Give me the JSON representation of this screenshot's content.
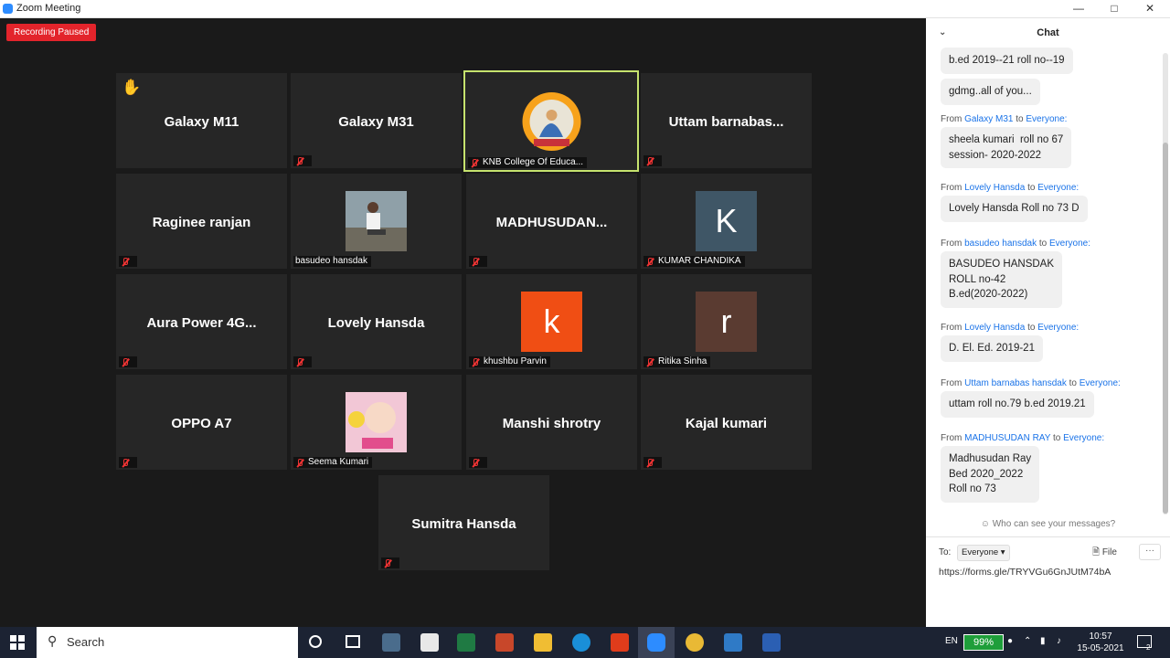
{
  "window": {
    "title": "Zoom Meeting"
  },
  "meeting": {
    "recording_badge": "Recording Paused",
    "tiles": [
      {
        "name": "Galaxy M11",
        "label": "",
        "muted": false,
        "hand": true
      },
      {
        "name": "Galaxy M31",
        "label": "",
        "muted": true
      },
      {
        "name": "",
        "label": "KNB College Of Educa...",
        "muted": true,
        "active": true,
        "image": "college-logo"
      },
      {
        "name": "Uttam  barnabas...",
        "label": "",
        "muted": true
      },
      {
        "name": "Raginee ranjan",
        "label": "",
        "muted": true
      },
      {
        "name": "",
        "label": "basudeo hansdak",
        "muted": false,
        "image": "person-photo"
      },
      {
        "name": "MADHUSUDAN...",
        "label": "",
        "muted": true
      },
      {
        "name": "",
        "label": "KUMAR CHANDIKA",
        "muted": true,
        "letter": "K",
        "color": "#3f5666"
      },
      {
        "name": "Aura Power 4G...",
        "label": "",
        "muted": true
      },
      {
        "name": "Lovely Hansda",
        "label": "",
        "muted": true
      },
      {
        "name": "",
        "label": "khushbu Parvin",
        "muted": true,
        "letter": "k",
        "color": "#f04e14"
      },
      {
        "name": "",
        "label": "Ritika Sinha",
        "muted": true,
        "letter": "r",
        "color": "#5a3b31"
      },
      {
        "name": "OPPO A7",
        "label": "",
        "muted": true
      },
      {
        "name": "",
        "label": "Seema Kumari",
        "muted": true,
        "image": "baby-photo"
      },
      {
        "name": "Manshi shrotry",
        "label": "",
        "muted": true
      },
      {
        "name": "Kajal kumari",
        "label": "",
        "muted": true
      },
      {
        "name": "Sumitra Hansda",
        "label": "",
        "muted": true
      }
    ]
  },
  "chat": {
    "title": "Chat",
    "who_can_see": "Who can see your messages?",
    "to_label": "To:",
    "to_value": "Everyone",
    "file_label": "File",
    "more_label": "···",
    "input_value": "https://forms.gle/TRYVGu6GnJUtM74bA",
    "messages": [
      {
        "from": "",
        "text": "b.ed 2019--21 roll no--19"
      },
      {
        "from": "",
        "text": "gdmg..all of you..."
      },
      {
        "from": "Galaxy M31",
        "text": "sheela kumari  roll no 67\nsession- 2020-2022"
      },
      {
        "from": "Lovely Hansda",
        "text": "Lovely Hansda Roll no 73 D"
      },
      {
        "from": "basudeo hansdak",
        "text": "BASUDEO HANSDAK\nROLL no-42\nB.ed(2020-2022)"
      },
      {
        "from": "Lovely Hansda",
        "text": "D. El. Ed. 2019-21"
      },
      {
        "from": "Uttam barnabas hansdak",
        "text": "uttam roll no.79 b.ed 2019.21"
      },
      {
        "from": "MADHUSUDAN RAY",
        "text": "Madhusudan Ray\nBed 2020_2022\nRoll no 73"
      }
    ],
    "from_word": "From",
    "to_word": "to",
    "everyone_word": "Everyone:"
  },
  "taskbar": {
    "search_placeholder": "Search",
    "lang": "EN",
    "battery": "99%",
    "time": "10:57",
    "date": "15-05-2021",
    "notification_count": "2"
  }
}
